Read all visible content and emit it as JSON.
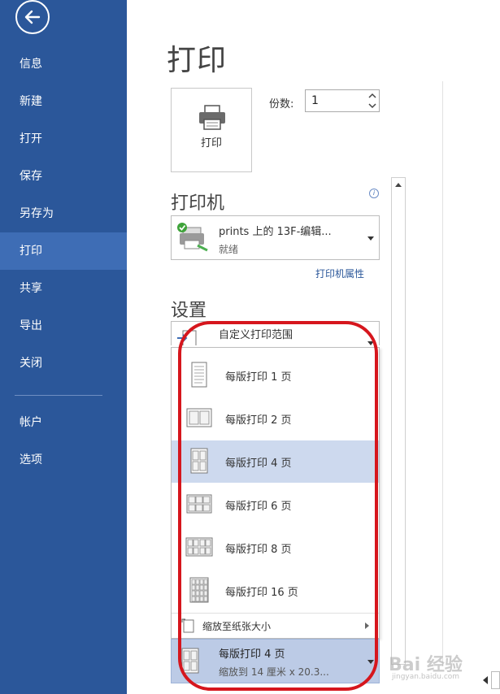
{
  "sidebar": {
    "items": [
      {
        "label": "信息"
      },
      {
        "label": "新建"
      },
      {
        "label": "打开"
      },
      {
        "label": "保存"
      },
      {
        "label": "另存为"
      },
      {
        "label": "打印"
      },
      {
        "label": "共享"
      },
      {
        "label": "导出"
      },
      {
        "label": "关闭"
      },
      {
        "label": "帐户"
      },
      {
        "label": "选项"
      }
    ],
    "active": "打印"
  },
  "main": {
    "title": "打印",
    "print_button_label": "打印",
    "copies_label": "份数:",
    "copies_value": "1"
  },
  "printer": {
    "heading": "打印机",
    "name": "prints 上的 13F-编辑...",
    "status": "就绪",
    "properties_link": "打印机属性"
  },
  "settings": {
    "heading": "设置",
    "range_title": "自定义打印范围",
    "dropdown": [
      {
        "label": "每版打印 1 页",
        "selected": false
      },
      {
        "label": "每版打印 2 页",
        "selected": false
      },
      {
        "label": "每版打印 4 页",
        "selected": true
      },
      {
        "label": "每版打印 6 页",
        "selected": false
      },
      {
        "label": "每版打印 8 页",
        "selected": false
      },
      {
        "label": "每版打印 16 页",
        "selected": false
      }
    ],
    "scale_label": "缩放至纸张大小",
    "pages_per_sheet_title": "每版打印 4 页",
    "pages_per_sheet_sub": "缩放到 14 厘米 x 20.3..."
  },
  "watermark": {
    "text": "Bai 经验",
    "sub": "jingyan.baidu.com"
  },
  "colors": {
    "sidebar": "#2b579a",
    "sidebar_active": "#3e6db5",
    "selected": "#cdd9ee",
    "annotation": "#d6161d"
  }
}
